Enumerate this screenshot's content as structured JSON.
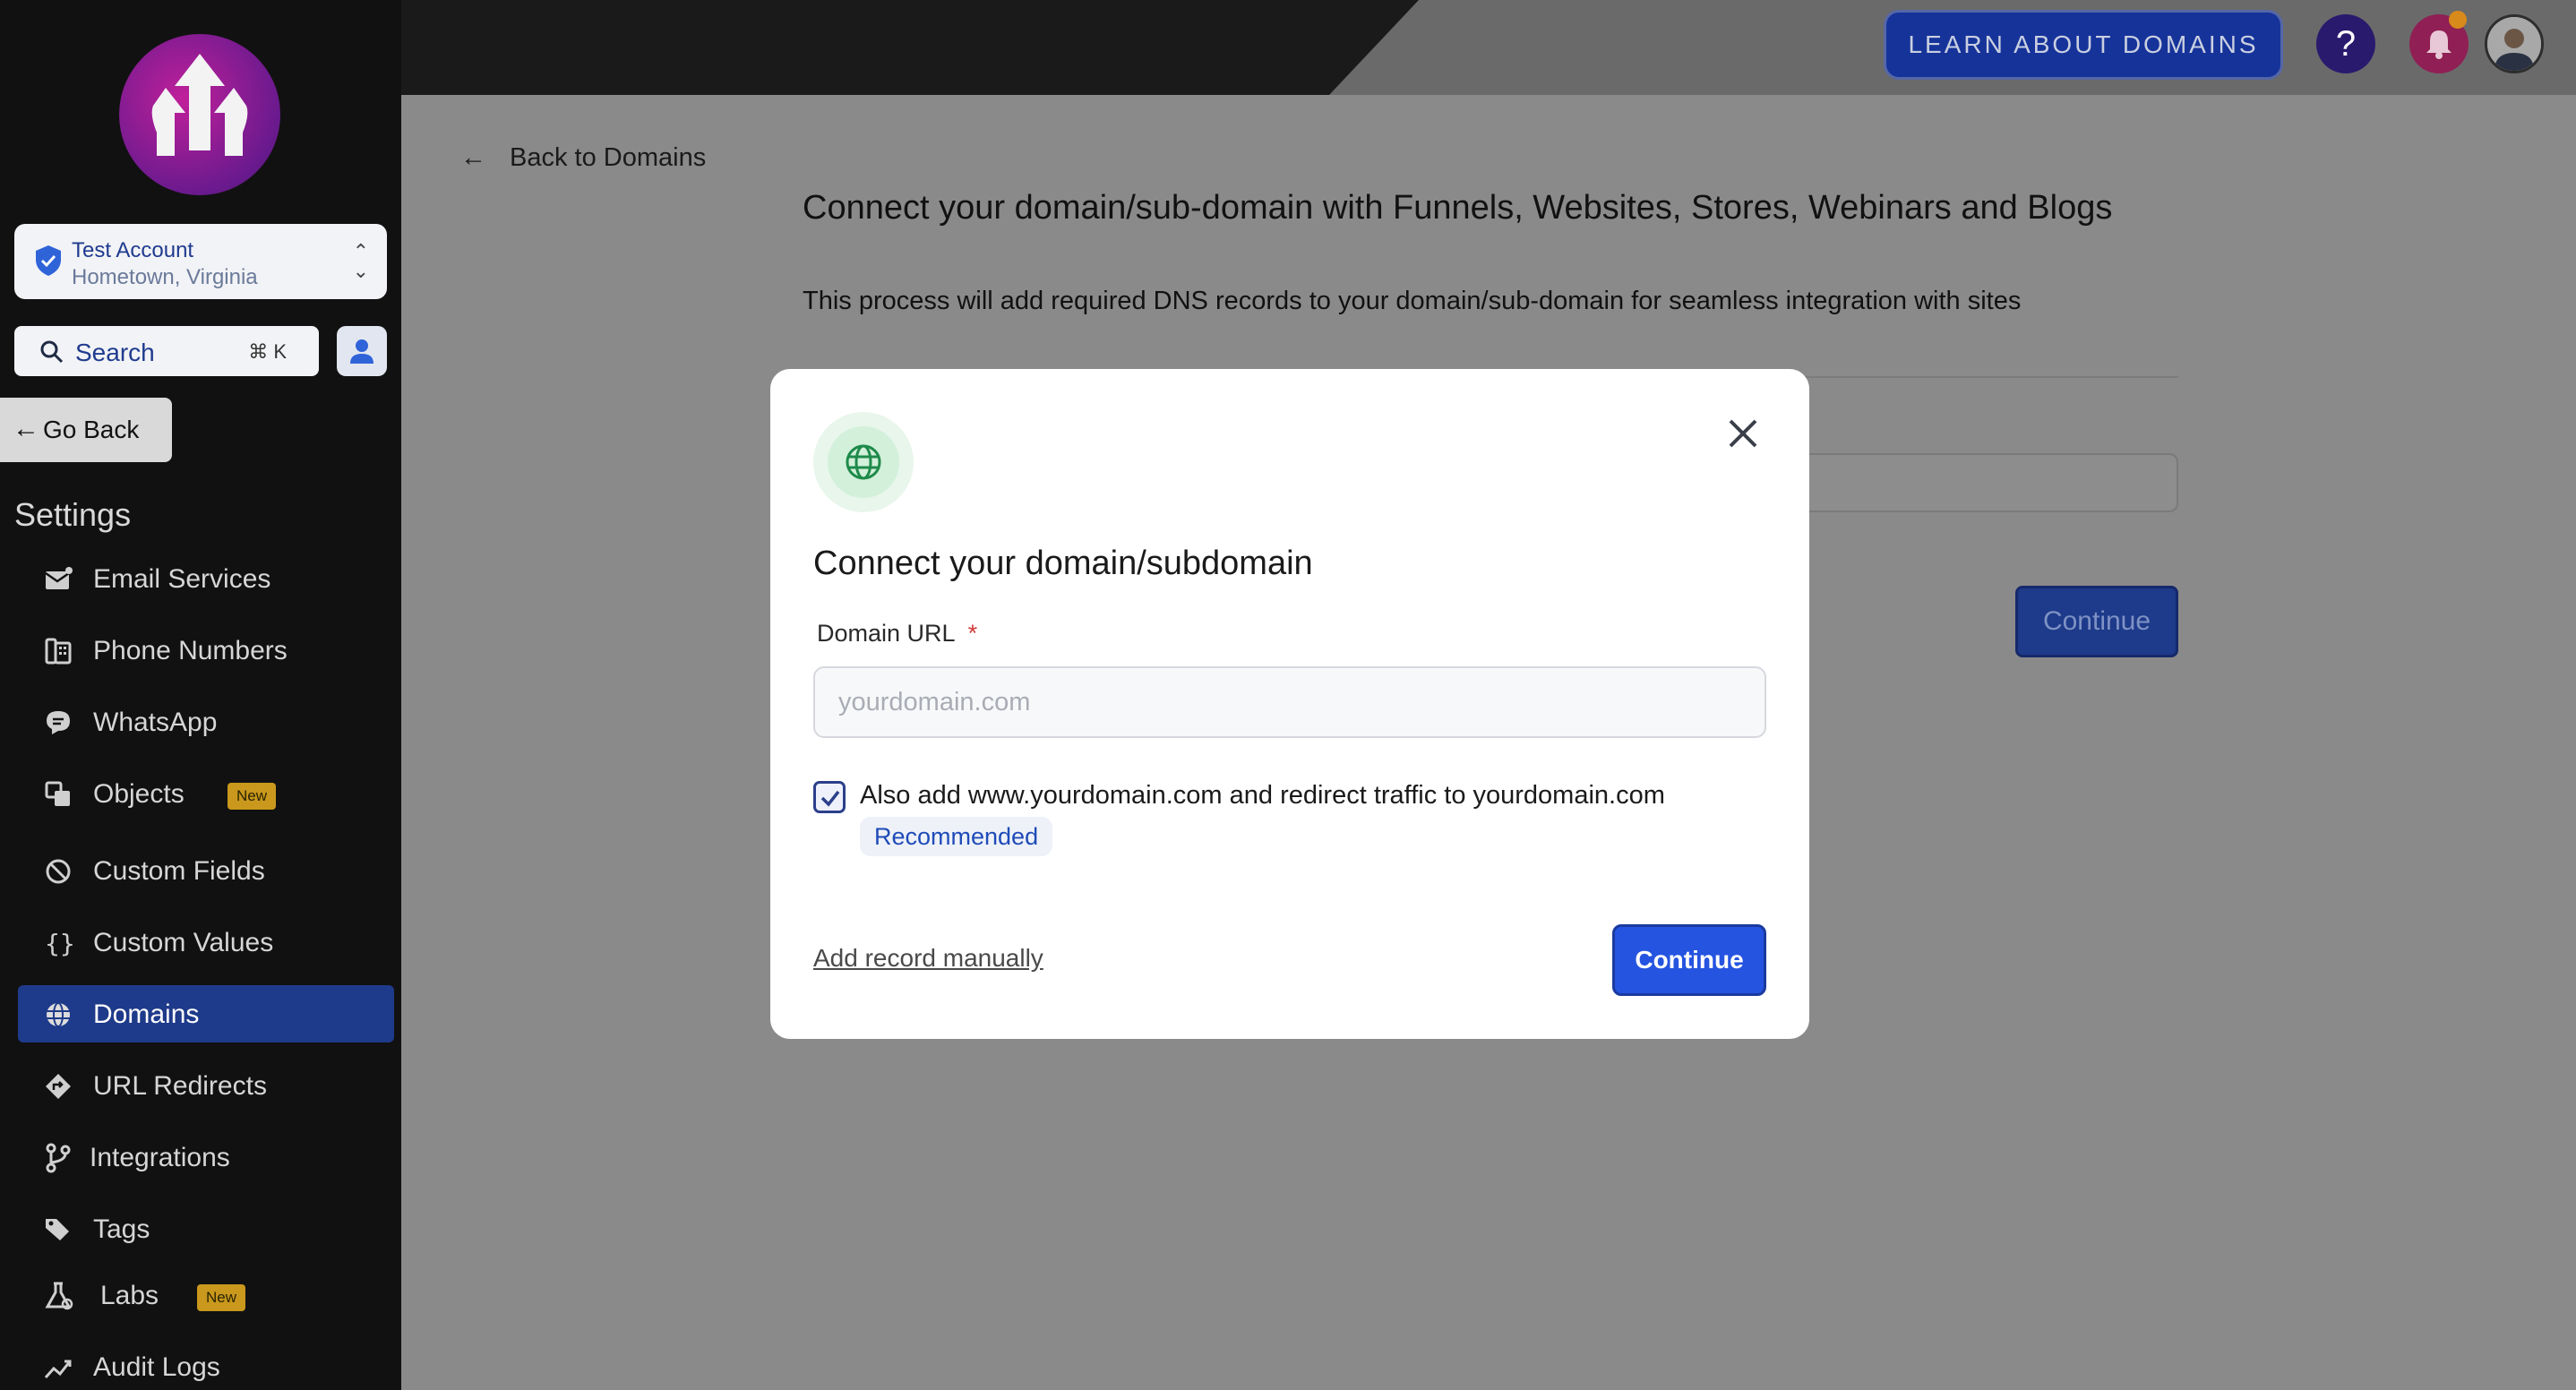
{
  "sidebar": {
    "account": {
      "name": "Test Account",
      "location": "Hometown, Virginia"
    },
    "search": {
      "label": "Search",
      "shortcut": "⌘ K"
    },
    "go_back": "Go Back",
    "settings_title": "Settings",
    "items": [
      {
        "label": "Email Services",
        "icon": "envelope-icon"
      },
      {
        "label": "Phone Numbers",
        "icon": "phone-numbers-icon"
      },
      {
        "label": "WhatsApp",
        "icon": "chat-bubble-icon"
      },
      {
        "label": "Objects",
        "icon": "objects-icon",
        "badge": "New"
      },
      {
        "label": "Custom Fields",
        "icon": "custom-fields-icon"
      },
      {
        "label": "Custom Values",
        "icon": "braces-icon"
      },
      {
        "label": "Domains",
        "icon": "globe-icon",
        "active": true
      },
      {
        "label": "URL Redirects",
        "icon": "redirect-icon"
      },
      {
        "label": "Integrations",
        "icon": "branch-icon"
      },
      {
        "label": "Tags",
        "icon": "tags-icon"
      },
      {
        "label": "Labs",
        "icon": "flask-icon",
        "badge": "New"
      },
      {
        "label": "Audit Logs",
        "icon": "chart-icon"
      }
    ]
  },
  "topbar": {
    "learn_button": "LEARN ABOUT DOMAINS",
    "help": "?"
  },
  "page": {
    "back_link": "Back to Domains",
    "title": "Connect your domain/sub-domain with Funnels, Websites, Stores, Webinars and Blogs",
    "subtitle": "This process will add required DNS records to your domain/sub-domain for seamless integration with sites",
    "continue": "Continue"
  },
  "modal": {
    "title": "Connect your domain/subdomain",
    "field_label": "Domain URL",
    "required_mark": "*",
    "placeholder": "yourdomain.com",
    "value": "",
    "checkbox_checked": true,
    "checkbox_text": "Also add www.yourdomain.com and redirect traffic to yourdomain.com",
    "recommended": "Recommended",
    "add_manually": "Add record manually",
    "continue": "Continue"
  },
  "colors": {
    "sidebar_bg": "#111111",
    "active_nav": "#1e3a8a",
    "primary_button": "#2554e0",
    "badge_new": "#c9981c"
  }
}
